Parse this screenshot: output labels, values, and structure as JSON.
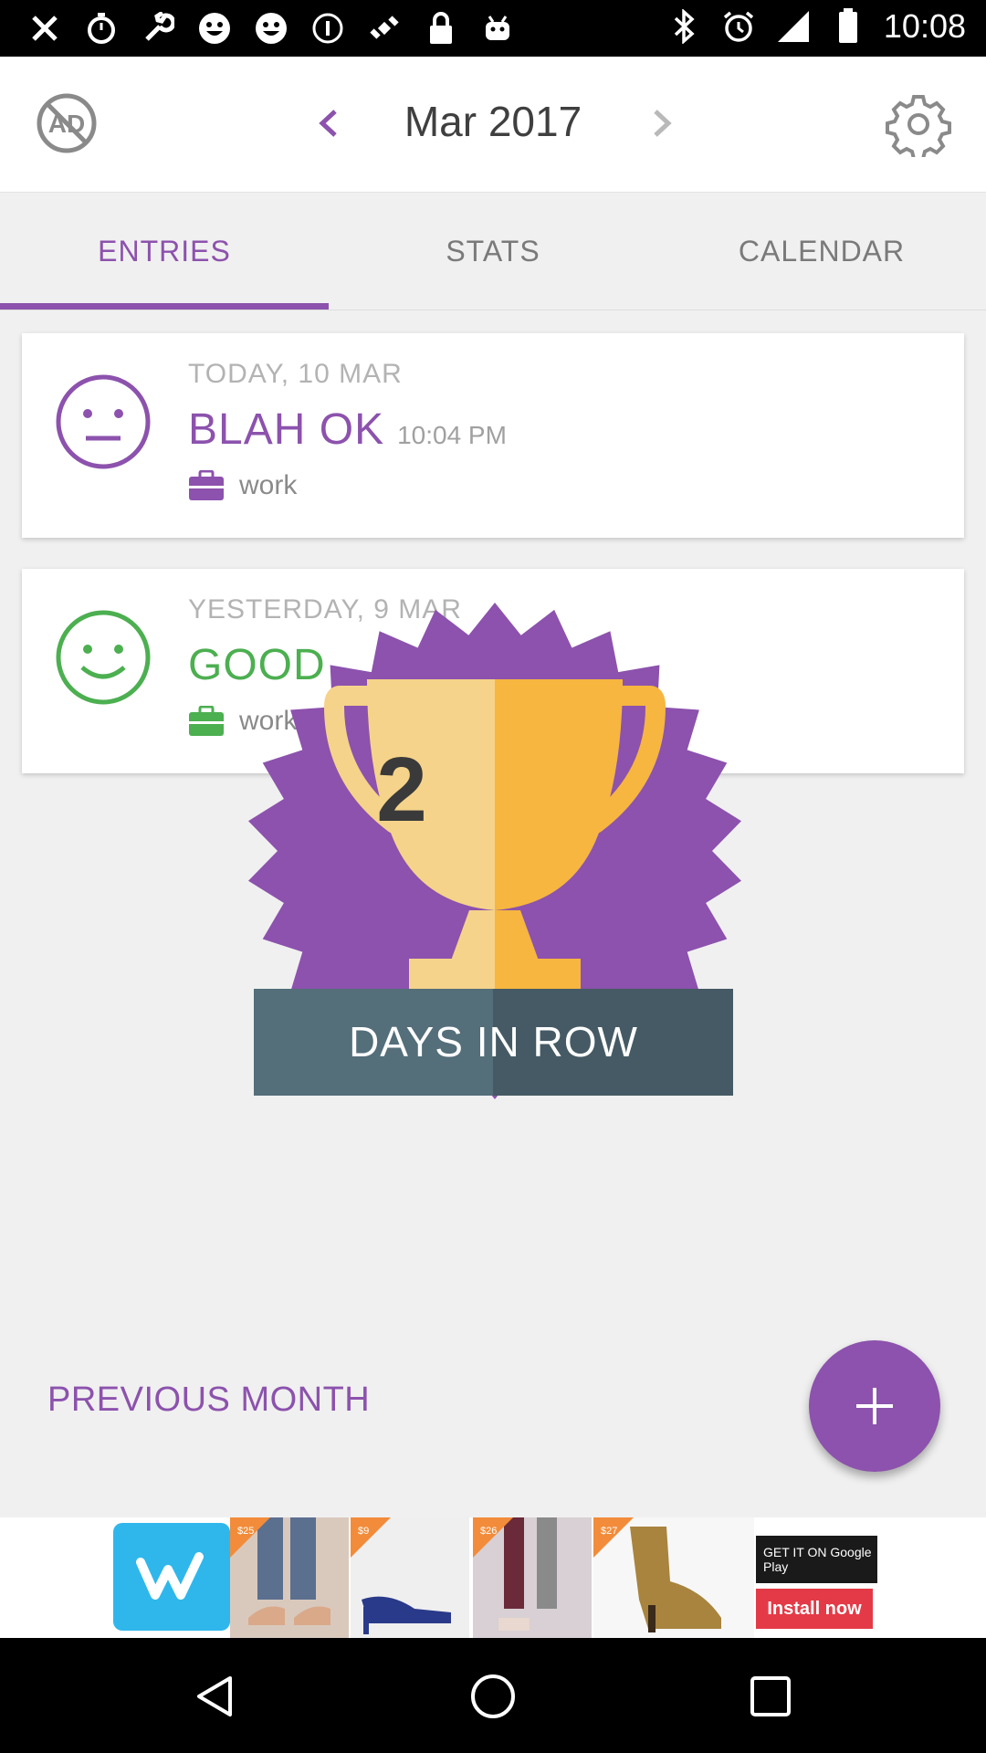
{
  "status_bar": {
    "time": "10:08",
    "left_icons": [
      "close-x-icon",
      "timer-icon",
      "wrench-icon",
      "smiley-icon",
      "smiley-icon",
      "info-icon",
      "satellite-icon",
      "lock-icon",
      "android-icon"
    ],
    "right_icons": [
      "bluetooth-icon",
      "alarm-icon",
      "signal-icon",
      "battery-icon"
    ]
  },
  "header": {
    "month": "Mar 2017"
  },
  "tabs": [
    {
      "label": "ENTRIES",
      "active": true
    },
    {
      "label": "STATS",
      "active": false
    },
    {
      "label": "CALENDAR",
      "active": false
    }
  ],
  "entries": [
    {
      "date": "TODAY, 10 MAR",
      "mood": "BLAH OK",
      "time": "10:04 PM",
      "activity": "work",
      "color": "#8c52ad",
      "face": "neutral-face-icon"
    },
    {
      "date": "YESTERDAY, 9 MAR",
      "mood": "GOOD",
      "time": "",
      "activity": "work",
      "color": "#4caf50",
      "face": "smiling-face-icon"
    }
  ],
  "achievement": {
    "count": "2",
    "label": "DAYS IN ROW"
  },
  "footer": {
    "previous_month": "PREVIOUS MONTH"
  },
  "ad": {
    "price_tags": [
      "$25",
      "$9",
      "$26",
      "$27"
    ],
    "store_text": "GET IT ON Google Play",
    "install": "Install now"
  },
  "colors": {
    "accent": "#8c52ad",
    "good": "#4caf50",
    "banner": "#546e7a"
  }
}
